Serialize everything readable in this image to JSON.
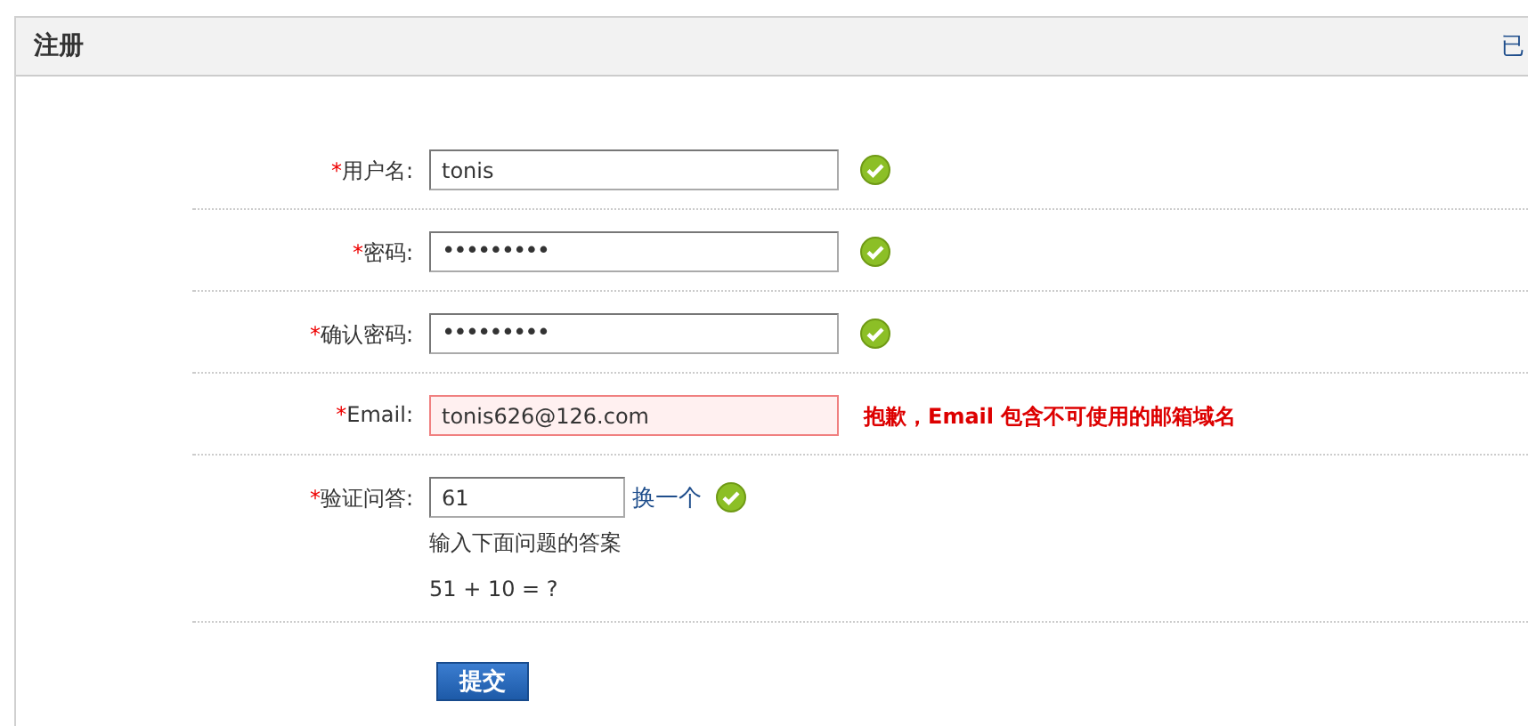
{
  "panel": {
    "title": "注册",
    "header_link": "已"
  },
  "fields": [
    {
      "kind": "text",
      "mark": "*",
      "label": "用户名:",
      "value": "tonis",
      "valid": true
    },
    {
      "kind": "password",
      "mark": "*",
      "label": "密码:",
      "value": "•••••••••",
      "valid": true
    },
    {
      "kind": "password",
      "mark": "*",
      "label": "确认密码:",
      "value": "•••••••••",
      "valid": true
    },
    {
      "kind": "text",
      "mark": "*",
      "label": "Email:",
      "value": "tonis626@126.com",
      "valid": false,
      "message": "抱歉，Email 包含不可使用的邮箱域名"
    }
  ],
  "captcha": {
    "mark": "*",
    "label": "验证问答:",
    "value": "61",
    "refresh_link": "换一个",
    "valid": true,
    "hint": "输入下面问题的答案",
    "question": "51 + 10 = ?"
  },
  "submit": "提交"
}
